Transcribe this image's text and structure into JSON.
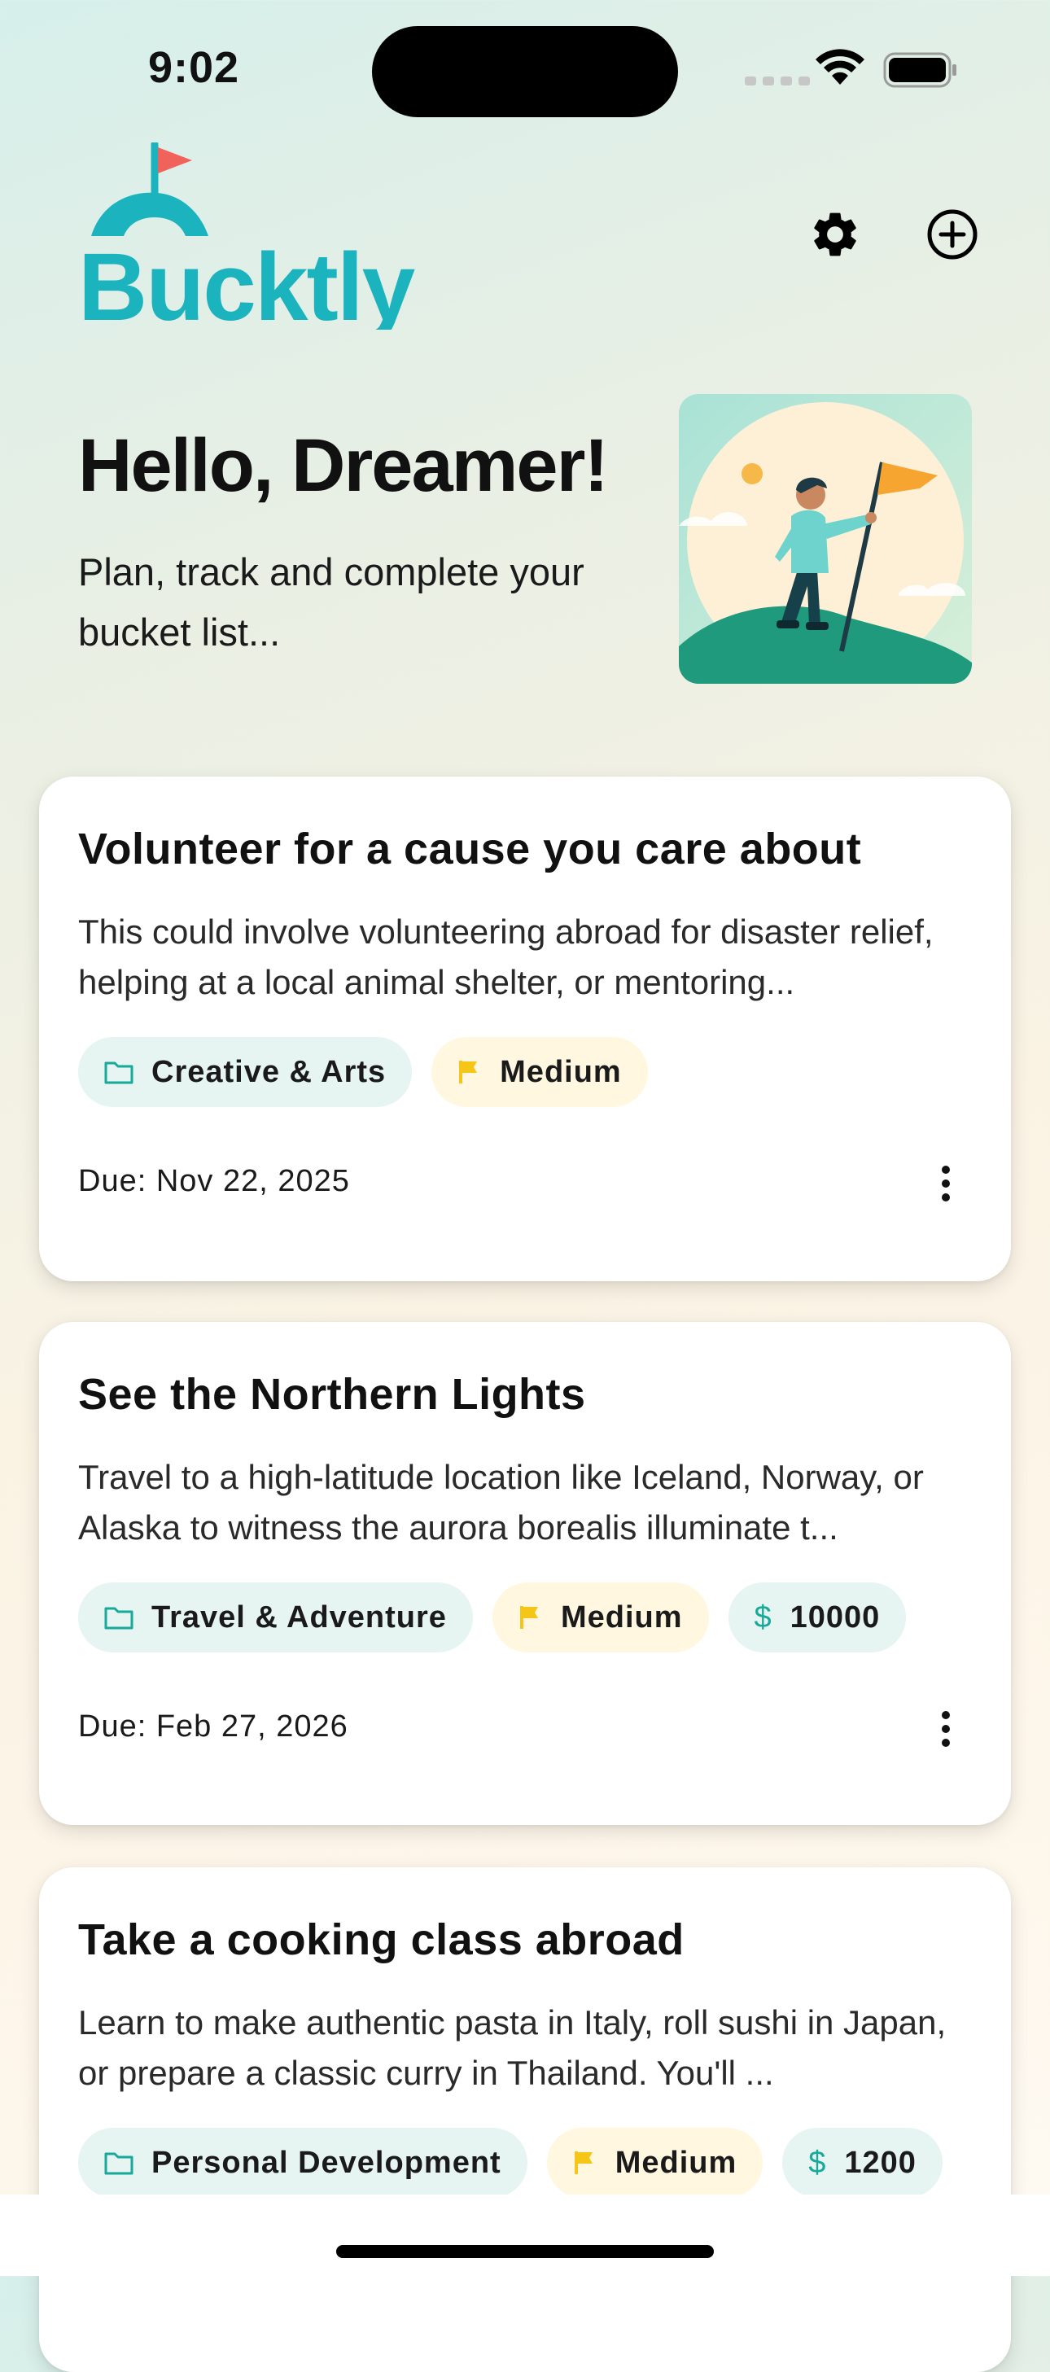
{
  "status_bar": {
    "time": "9:02"
  },
  "app": {
    "name": "Bucktly",
    "brand_color": "#1bb3bd",
    "flag_color": "#f0625a"
  },
  "hero": {
    "greeting": "Hello, Dreamer!",
    "subtitle": "Plan, track and complete your bucket list..."
  },
  "header": {
    "settings_icon": "gear-icon",
    "add_icon": "plus-circle-icon"
  },
  "goals": [
    {
      "title": "Volunteer for a cause you care about",
      "description": "This could involve volunteering abroad for disaster relief, helping at a local animal shelter, or mentoring...",
      "category": "Creative & Arts",
      "priority": "Medium",
      "budget": null,
      "due": "Due: Nov 22, 2025"
    },
    {
      "title": "See the Northern Lights",
      "description": "Travel to a high-latitude location like Iceland, Norway, or Alaska to witness the aurora borealis illuminate t...",
      "category": "Travel & Adventure",
      "priority": "Medium",
      "budget": "10000",
      "due": "Due: Feb 27, 2026"
    },
    {
      "title": "Take a cooking class abroad",
      "description": "Learn to make authentic pasta in Italy, roll sushi in Japan, or prepare a classic curry in Thailand. You'll ...",
      "category": "Personal Development",
      "priority": "Medium",
      "budget": "1200",
      "due": ""
    }
  ],
  "colors": {
    "chip_teal_bg": "#e6f4f2",
    "chip_yellow_bg": "#fff7df",
    "flag_yellow": "#f5c518",
    "folder_teal": "#18a99a"
  }
}
